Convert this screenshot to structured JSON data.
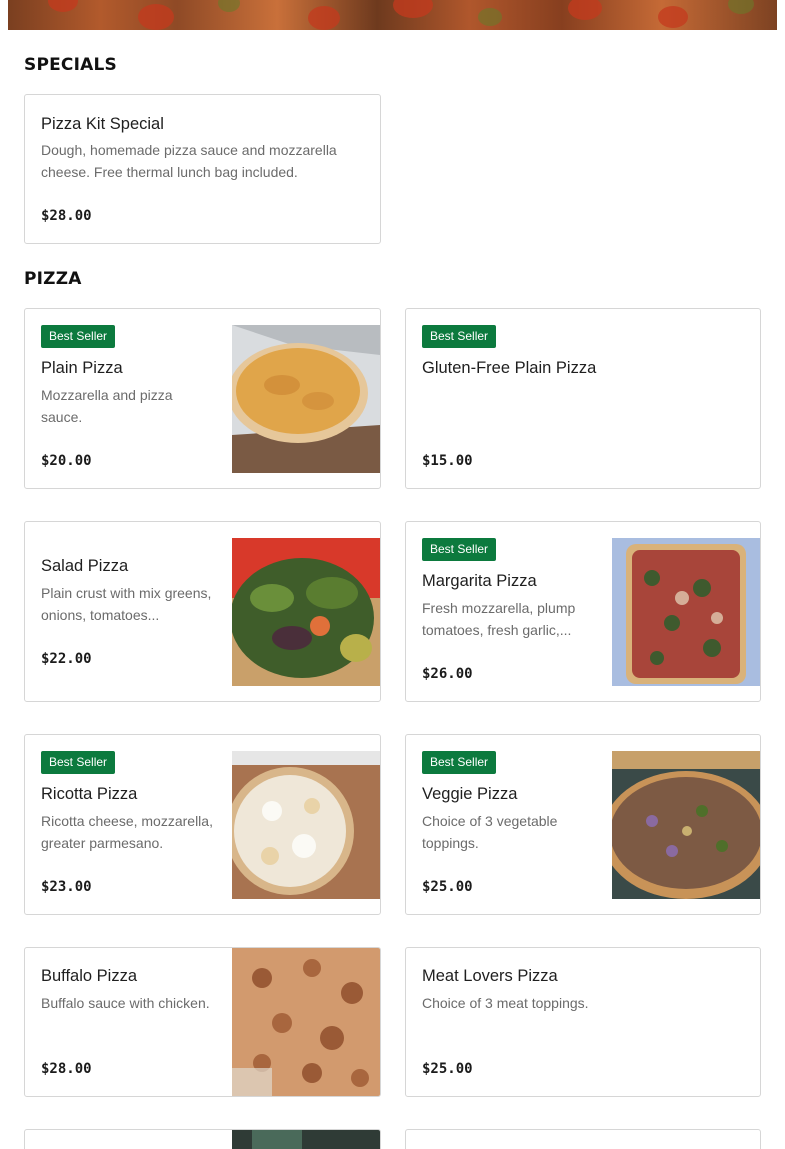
{
  "sections": {
    "specials": {
      "title": "SPECIALS",
      "items": [
        {
          "name": "Pizza Kit Special",
          "desc": "Dough, homemade pizza sauce and mozzarella cheese. Free thermal lunch bag included.",
          "price": "$28.00"
        }
      ]
    },
    "pizza": {
      "title": "PIZZA",
      "badge_label": "Best Seller",
      "items": [
        {
          "name": "Plain Pizza",
          "desc": "Mozzarella and pizza sauce.",
          "price": "$20.00",
          "best_seller": true,
          "image": "plain-pizza-photo"
        },
        {
          "name": "Gluten-Free Plain Pizza",
          "desc": "",
          "price": "$15.00",
          "best_seller": true
        },
        {
          "name": "Salad Pizza",
          "desc": "Plain crust with mix greens, onions, tomatoes...",
          "price": "$22.00",
          "best_seller": false,
          "image": "salad-pizza-photo"
        },
        {
          "name": "Margarita Pizza",
          "desc": "Fresh mozzarella, plump tomatoes, fresh garlic,...",
          "price": "$26.00",
          "best_seller": true,
          "image": "margarita-pizza-photo"
        },
        {
          "name": "Ricotta Pizza",
          "desc": "Ricotta cheese, mozzarella, greater parmesano.",
          "price": "$23.00",
          "best_seller": true,
          "image": "ricotta-pizza-photo"
        },
        {
          "name": "Veggie Pizza",
          "desc": "Choice of 3 vegetable toppings.",
          "price": "$25.00",
          "best_seller": true,
          "image": "veggie-pizza-photo"
        },
        {
          "name": "Buffalo Pizza",
          "desc": "Buffalo sauce with chicken.",
          "price": "$28.00",
          "best_seller": false,
          "image": "buffalo-pizza-photo"
        },
        {
          "name": "Meat Lovers Pizza",
          "desc": "Choice of 3 meat toppings.",
          "price": "$25.00",
          "best_seller": false
        }
      ]
    }
  },
  "colors": {
    "badge": "#0c7a3e",
    "card_border": "#d6d6d6",
    "desc_text": "#6b6b6b"
  }
}
